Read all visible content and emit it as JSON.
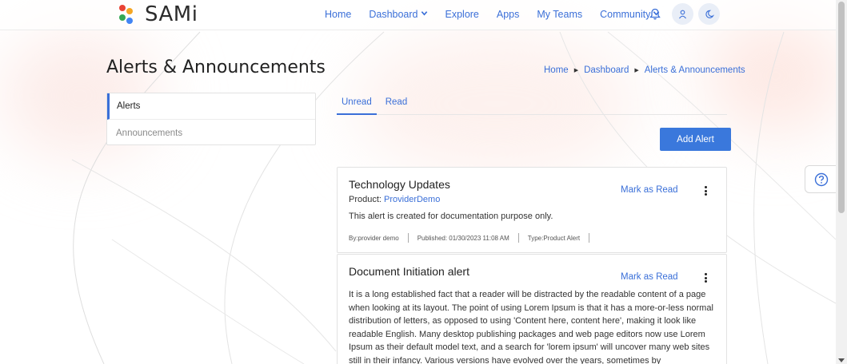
{
  "brand": {
    "name": "SAMi",
    "dot_colors": [
      "#e94335",
      "#f5a623",
      "#34a853",
      "#4285f4"
    ]
  },
  "nav": {
    "links": [
      {
        "label": "Home"
      },
      {
        "label": "Dashboard",
        "dropdown": true
      },
      {
        "label": "Explore"
      },
      {
        "label": "Apps"
      },
      {
        "label": "My Teams"
      },
      {
        "label": "Community",
        "dropdown": true
      }
    ],
    "icons": [
      "bell-icon",
      "user-icon",
      "moon-icon"
    ]
  },
  "page": {
    "title": "Alerts & Announcements",
    "breadcrumb": [
      "Home",
      "Dashboard",
      "Alerts & Announcements"
    ]
  },
  "side_menu": {
    "items": [
      {
        "label": "Alerts",
        "active": true
      },
      {
        "label": "Announcements",
        "active": false
      }
    ]
  },
  "tabs": [
    {
      "label": "Unread",
      "active": true
    },
    {
      "label": "Read",
      "active": false
    }
  ],
  "add_button": "Add Alert",
  "alerts": [
    {
      "title": "Technology Updates",
      "product_label": "Product:",
      "product_value": "ProviderDemo",
      "description": "This alert is created for documentation purpose only.",
      "by": "By:provider demo",
      "published": "Published: 01/30/2023 11:08 AM",
      "type": "Type:Product Alert",
      "action": "Mark as Read"
    },
    {
      "title": "Document Initiation alert",
      "action": "Mark as Read",
      "body": "It is a long established fact that a reader will be distracted by the readable content of a page when looking at its layout. The point of using Lorem Ipsum is that it has a more-or-less normal distribution of letters, as opposed to using 'Content here, content here', making it look like readable English. Many desktop publishing packages and web page editors now use Lorem Ipsum as their default model text, and a search for 'lorem ipsum' will uncover many web sites still in their infancy. Various versions have evolved over the years, sometimes by"
    }
  ],
  "colors": {
    "accent": "#3a6fd8",
    "button": "#3a78dc"
  }
}
